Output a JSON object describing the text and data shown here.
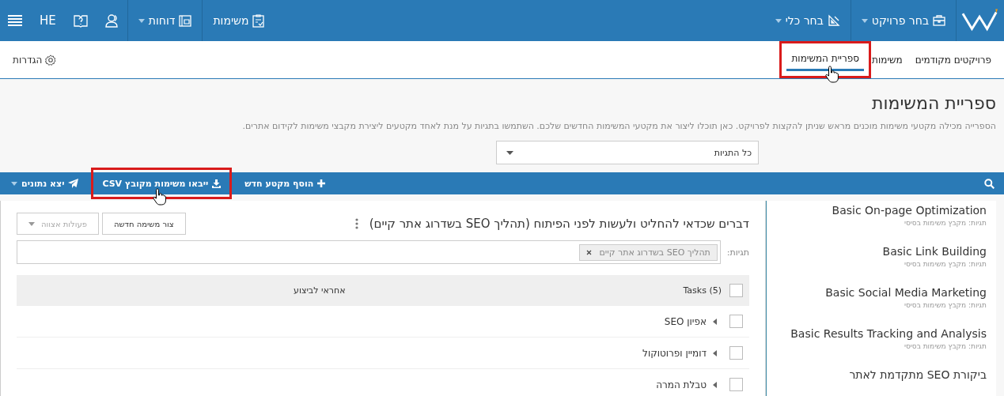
{
  "topbar": {
    "nav": [
      {
        "label": "בחר פרויקט",
        "dropdown": true
      },
      {
        "label": "בחר כלי",
        "dropdown": true
      }
    ],
    "nav_left": [
      {
        "label": "משימות",
        "dropdown": false
      },
      {
        "label": "דוחות",
        "dropdown": true
      }
    ],
    "language": "HE"
  },
  "subnav": {
    "tabs": [
      {
        "label": "פרויקטים מקודמים",
        "selected": false,
        "highlighted": false
      },
      {
        "label": "משימות",
        "selected": false,
        "highlighted": false
      },
      {
        "label": "ספריית המשימות",
        "selected": true,
        "highlighted": true
      }
    ],
    "settings": "הגדרות"
  },
  "page": {
    "title": "ספריית המשימות",
    "description": "הספרייה מכילה מקטעי משימות מוכנים מראש שניתן להקצות לפרויקט. כאן תוכלו ליצור את מקטעי המשימות החדשים שלכם. השתמשו בתגיות על מנת לאחד מקטעים ליצירת מקבצי משימות לקידום אתרים.",
    "tag_filter": "כל התגיות"
  },
  "toolbar": {
    "buttons": [
      {
        "label": "הוסף מקטע חדש",
        "highlighted": false
      },
      {
        "label": "ייבאו משימות מקובץ CSV",
        "highlighted": true
      }
    ],
    "export": "יצא נתונים"
  },
  "sidebar": {
    "items": [
      {
        "title": "Basic On-page Optimization",
        "tags": "תגיות: מקבץ משימות בסיסי"
      },
      {
        "title": "Basic Link Building",
        "tags": "תגיות: מקבץ משימות בסיסי"
      },
      {
        "title": "Basic Social Media Marketing",
        "tags": "תגיות: מקבץ משימות בסיסי"
      },
      {
        "title": "Basic Results Tracking and Analysis",
        "tags": "תגיות: מקבץ משימות בסיסי"
      },
      {
        "title": "ביקורת SEO מתקדמת לאתר"
      }
    ]
  },
  "section": {
    "title": "דברים שכדאי להחליט ולעשות לפני הפיתוח (תהליך SEO בשדרוג אתר קיים)",
    "new_task": "צור משימה חדשה",
    "bulk_actions": "פעולות אצווה",
    "tags_label": "תגיות:",
    "tags": [
      "תהליך SEO בשדרוג אתר קיים"
    ],
    "table": {
      "all_checked": false,
      "columns": [
        "Tasks (5)",
        "אחראי לביצוע"
      ],
      "rows": [
        {
          "name": "אפיון SEO",
          "checked": false
        },
        {
          "name": "דומיין ופרוטוקול",
          "checked": false
        },
        {
          "name": "טבלת המרה",
          "checked": false
        }
      ]
    }
  }
}
